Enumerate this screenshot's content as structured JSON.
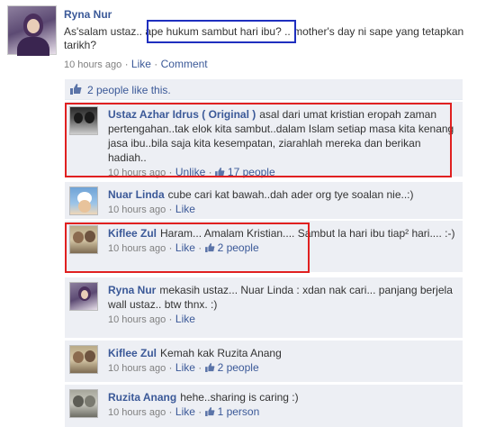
{
  "post": {
    "author": "Ryna Nur",
    "text_before": "As'salam ustaz.. ",
    "text_question": "ape hukum sambut hari ibu?",
    "text_after": " .. mother's day ni sape yang tetapkan tarikh?",
    "time": "10 hours ago",
    "like_label": "Like",
    "comment_label": "Comment"
  },
  "likes": {
    "text": "2 people like this."
  },
  "comments": [
    {
      "author": "Ustaz Azhar Idrus ( Original )",
      "text": "asal dari umat kristian eropah zaman pertengahan..tak elok kita sambut..dalam Islam setiap masa kita kenang jasa ibu..bila saja kita kesempatan, ziarahlah mereka dan berikan hadiah..",
      "time": "10 hours ago",
      "action": "Unlike",
      "likes": "17 people"
    },
    {
      "author": "Nuar Linda",
      "text": "cube cari kat bawah..dah ader org tye soalan nie..:)",
      "time": "10 hours ago",
      "action": "Like",
      "likes": ""
    },
    {
      "author": "Kiflee Zul",
      "text": "Haram... Amalam Kristian.... Sambut la hari ibu tiap² hari.... :-)",
      "time": "10 hours ago",
      "action": "Like",
      "likes": "2 people"
    },
    {
      "author": "Ryna Nur",
      "text": "mekasih ustaz... Nuar Linda : xdan nak cari... panjang berjela wall ustaz.. btw thnx. :)",
      "time": "10 hours ago",
      "action": "Like",
      "likes": ""
    },
    {
      "author": "Kiflee Zul",
      "text": "Kemah kak Ruzita Anang",
      "time": "10 hours ago",
      "action": "Like",
      "likes": "2 people"
    },
    {
      "author": "Ruzita Anang",
      "text": "hehe..sharing is caring :)",
      "time": "10 hours ago",
      "action": "Like",
      "likes": "1 person"
    }
  ],
  "colors": {
    "link": "#3b5998",
    "comment_bg": "#edeff4",
    "highlight_red": "#e02020",
    "highlight_blue": "#1f2fbf"
  }
}
